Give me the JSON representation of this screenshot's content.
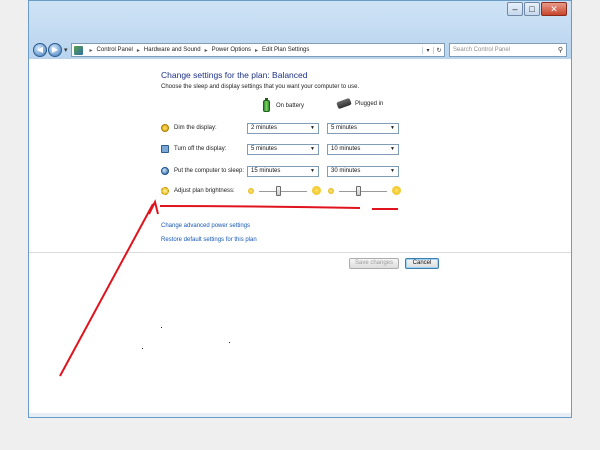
{
  "window": {
    "controls": {
      "minimize": "–",
      "maximize": "□",
      "close": "✕"
    }
  },
  "nav": {
    "breadcrumbs": [
      "Control Panel",
      "Hardware and Sound",
      "Power Options",
      "Edit Plan Settings"
    ],
    "search_placeholder": "Search Control Panel",
    "icons": {
      "back": "back-arrow-icon",
      "forward": "forward-arrow-icon",
      "refresh": "refresh-icon",
      "search": "search-icon"
    }
  },
  "plan": {
    "title": "Change settings for the plan: Balanced",
    "subtitle": "Choose the sleep and display settings that you want your computer to use.",
    "columns": {
      "battery": "On battery",
      "plugged": "Plugged in"
    },
    "rows": [
      {
        "label": "Dim the display:",
        "battery": "2 minutes",
        "plugged": "5 minutes"
      },
      {
        "label": "Turn off the display:",
        "battery": "5 minutes",
        "plugged": "10 minutes"
      },
      {
        "label": "Put the computer to sleep:",
        "battery": "15 minutes",
        "plugged": "30 minutes"
      }
    ],
    "brightness": {
      "label": "Adjust plan brightness:",
      "battery_level_pct": 40,
      "plugged_level_pct": 40
    }
  },
  "links": {
    "advanced": "Change advanced power settings",
    "restore": "Restore default settings for this plan"
  },
  "buttons": {
    "save": "Save changes",
    "cancel": "Cancel"
  },
  "colors": {
    "heading": "#1e3287",
    "link": "#1558b5",
    "annotation": "#e0141e"
  }
}
